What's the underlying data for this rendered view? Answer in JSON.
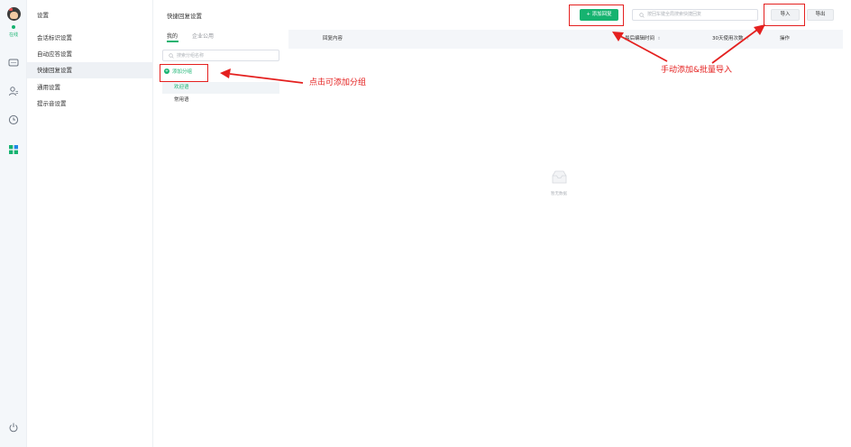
{
  "rail": {
    "status_label": "在线"
  },
  "menu": {
    "title": "设置",
    "items": [
      {
        "label": "会话标识设置"
      },
      {
        "label": "自动应答设置"
      },
      {
        "label": "快捷回复设置"
      },
      {
        "label": "通用设置"
      },
      {
        "label": "提示音设置"
      }
    ]
  },
  "header": {
    "title": "快捷回复设置",
    "add_button": "+ 添加回复",
    "search_placeholder": "按回车键全局搜索快捷回复",
    "import_button": "导入",
    "export_button": "导出"
  },
  "groups": {
    "tabs": [
      {
        "label": "我的"
      },
      {
        "label": "企业公用"
      }
    ],
    "search_placeholder": "搜索分组名称",
    "add_group_label": "添加分组",
    "items": [
      {
        "label": "欢迎语"
      },
      {
        "label": "常用语"
      }
    ]
  },
  "table": {
    "columns": [
      {
        "label": "回复内容"
      },
      {
        "label": "最后编辑时间"
      },
      {
        "label": "30天使用次数"
      },
      {
        "label": "操作"
      }
    ],
    "empty_text": "暂无数据"
  },
  "annotations": {
    "add_group_hint": "点击可添加分组",
    "add_import_hint": "手动添加&批量导入"
  },
  "colors": {
    "accent": "#16b370",
    "annotation": "#e4201f"
  }
}
